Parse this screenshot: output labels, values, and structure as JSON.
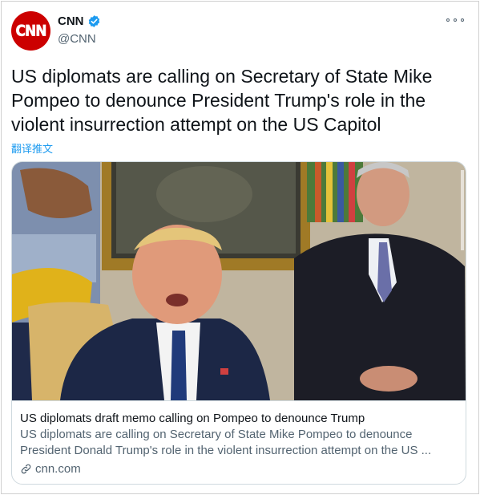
{
  "author": {
    "display_name": "CNN",
    "handle": "@CNN",
    "avatar_logo": "CNN",
    "brand_color": "#cc0000",
    "verified": true
  },
  "tweet": {
    "text": "US diplomats are calling on Secretary of State Mike Pompeo to denounce President Trump's role in the violent insurrection attempt on the US Capitol",
    "translate_label": "翻译推文"
  },
  "card": {
    "title": "US diplomats draft memo calling on Pompeo to denounce Trump",
    "description": "US diplomats are calling on Secretary of State Mike Pompeo to denounce President Donald Trump's role in the violent insurrection attempt on the US ...",
    "domain": "cnn.com",
    "image_icon": "press-photo"
  },
  "icons": {
    "more": "more-icon",
    "verified": "verified-badge-icon",
    "link": "link-icon"
  },
  "colors": {
    "accent": "#1d9bf0",
    "secondary_text": "#536471"
  }
}
